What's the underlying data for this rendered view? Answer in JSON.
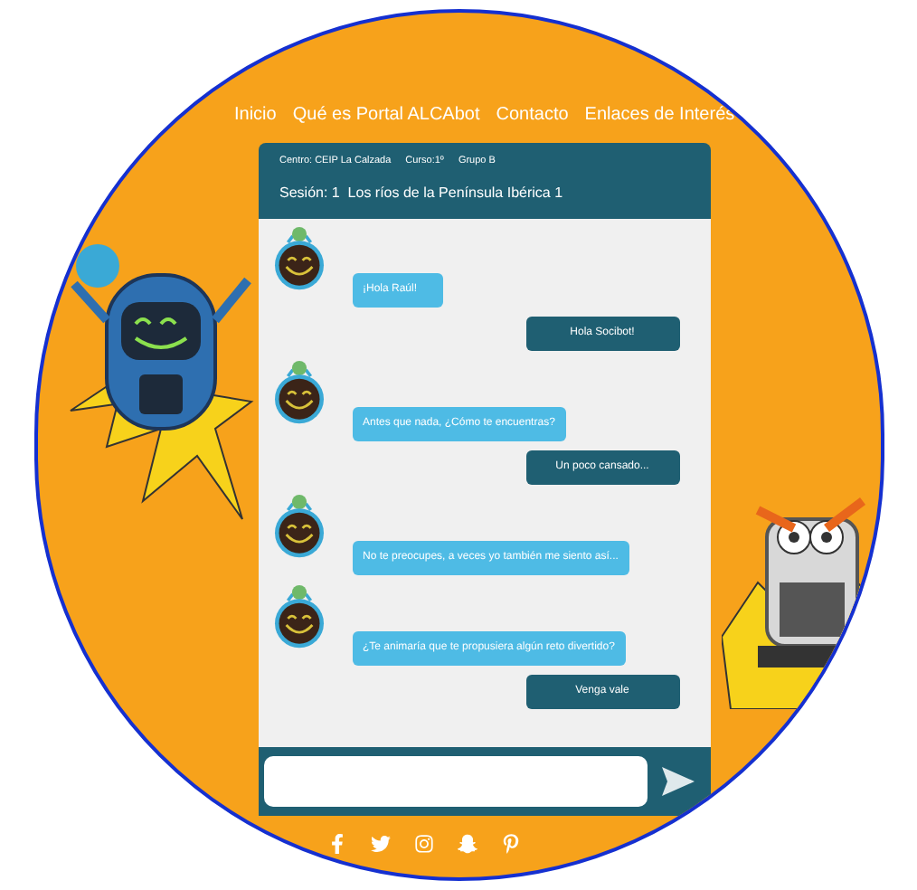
{
  "nav": [
    {
      "label": "Inicio"
    },
    {
      "label": "Qué es Portal ALCAbot"
    },
    {
      "label": "Contacto"
    },
    {
      "label": "Enlaces de Interés"
    }
  ],
  "chat": {
    "centro": "Centro: CEIP La Calzada",
    "curso": "Curso:1º",
    "grupo": "Grupo B",
    "session": "Sesión: 1  Los ríos de la Península Ibérica 1",
    "messages": [
      {
        "kind": "bot",
        "text": "¡Hola Raúl!"
      },
      {
        "kind": "user",
        "text": "Hola Socibot!"
      },
      {
        "kind": "bot",
        "text": "Antes que nada, ¿Cómo te encuentras?"
      },
      {
        "kind": "user",
        "text": "Un poco cansado..."
      },
      {
        "kind": "bot",
        "text": "No te preocupes, a veces yo también me siento así..."
      },
      {
        "kind": "bot",
        "text": "¿Te animaría que te propusiera algún reto divertido?"
      },
      {
        "kind": "user",
        "text": "Venga vale"
      }
    ]
  },
  "social": [
    {
      "kind": "facebook"
    },
    {
      "kind": "twitter"
    },
    {
      "kind": "instagram"
    },
    {
      "kind": "snapchat"
    },
    {
      "kind": "pinterest"
    }
  ]
}
